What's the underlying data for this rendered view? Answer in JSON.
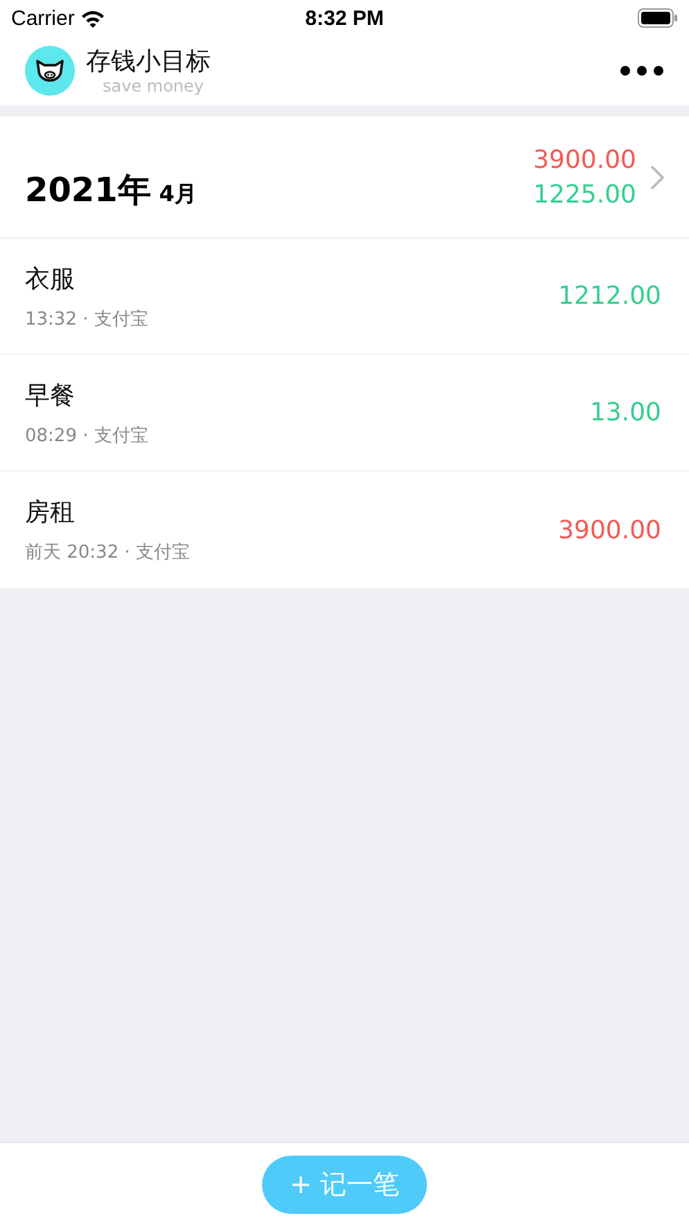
{
  "status_bar": {
    "carrier": "Carrier",
    "time": "8:32 PM"
  },
  "header": {
    "title": "存钱小目标",
    "subtitle": "save money"
  },
  "summary": {
    "year": "2021年",
    "month": "4月",
    "totals": [
      {
        "kind": "expense",
        "amount": "3900.00"
      },
      {
        "kind": "income",
        "amount": "1225.00"
      }
    ]
  },
  "records": [
    {
      "name": "衣服",
      "meta": "13:32 · 支付宝",
      "amount": "1212.00",
      "kind": "income"
    },
    {
      "name": "早餐",
      "meta": "08:29 · 支付宝",
      "amount": "13.00",
      "kind": "income"
    },
    {
      "name": "房租",
      "meta": "前天 20:32 · 支付宝",
      "amount": "3900.00",
      "kind": "expense"
    }
  ],
  "add_button": {
    "icon": "+",
    "label": "记一笔"
  }
}
